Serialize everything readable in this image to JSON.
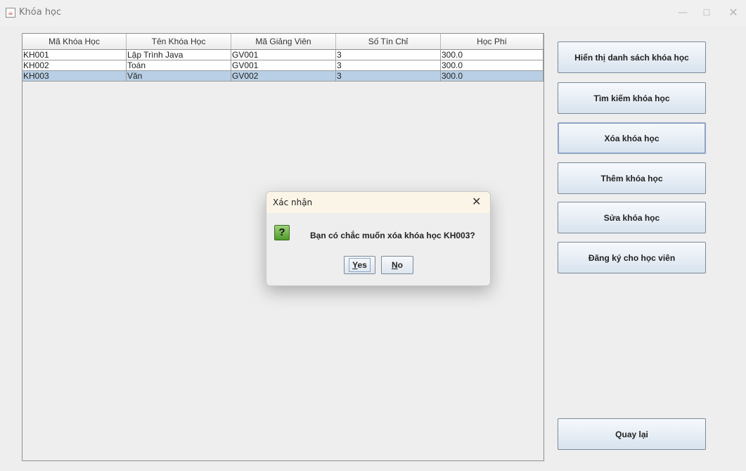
{
  "window": {
    "title": "Khóa học",
    "controls": {
      "minimize": "—",
      "maximize": "☐",
      "close": "✕"
    }
  },
  "table": {
    "columns": [
      "Mã Khóa Học",
      "Tên Khóa Học",
      "Mã Giảng Viên",
      "Số Tín Chỉ",
      "Học Phí"
    ],
    "rows": [
      [
        "KH001",
        "Lập Trình Java",
        "GV001",
        "3",
        "300.0"
      ],
      [
        "KH002",
        "Toán",
        "GV001",
        "3",
        "300.0"
      ],
      [
        "KH003",
        "Văn",
        "GV002",
        "3",
        "300.0"
      ]
    ],
    "selected_row": 2
  },
  "sidebar": {
    "show_list": "Hiển thị danh sách khóa học",
    "search": "Tìm kiếm khóa học",
    "delete": "Xóa khóa học",
    "add": "Thêm khóa học",
    "edit": "Sửa khóa học",
    "register": "Đăng ký cho học viên",
    "back": "Quay lại"
  },
  "dialog": {
    "title": "Xác nhận",
    "close": "✕",
    "icon": "question-icon",
    "icon_glyph": "?",
    "message": "Bạn có chắc muốn xóa khóa học KH003?",
    "yes_mnemonic": "Y",
    "yes_rest": "es",
    "no_mnemonic": "N",
    "no_rest": "o"
  }
}
